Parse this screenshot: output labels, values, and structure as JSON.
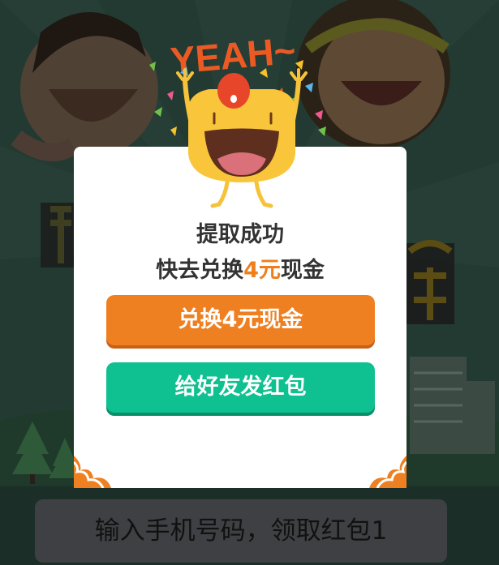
{
  "modal": {
    "title_line1": "提取成功",
    "title_line2_prefix": "快去兑换",
    "title_line2_amount": "4元",
    "title_line2_suffix": "现金",
    "exchange_button_label": "兑换4元现金",
    "share_button_label": "给好友发红包"
  },
  "mascot": {
    "yeah_text": "YEAH~"
  },
  "footer": {
    "phone_input_text": "输入手机号码，领取红包1"
  },
  "colors": {
    "accent_orange": "#ef8022",
    "accent_green": "#0fc090",
    "overlay_dark": "#233a32",
    "mascot_yellow": "#f9c53b"
  },
  "icons": [
    "mascot-character",
    "confetti-decoration",
    "cloud-corner-decoration",
    "tree-decoration"
  ]
}
